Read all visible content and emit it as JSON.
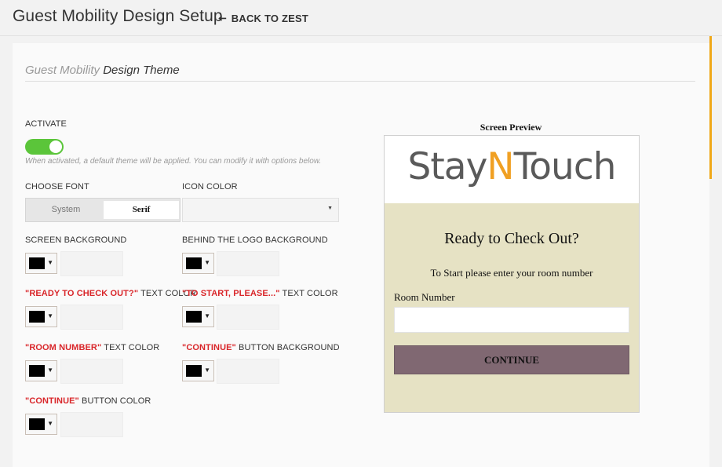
{
  "header": {
    "title": "Guest Mobility Design Setup",
    "back_label": "BACK TO ZEST"
  },
  "section": {
    "title_light": "Guest Mobility",
    "title_dark": "Design Theme"
  },
  "activate": {
    "label": "ACTIVATE",
    "state": "on",
    "helper": "When activated, a default theme will be applied. You can modify it with options below."
  },
  "font": {
    "label": "CHOOSE FONT",
    "options": [
      "System",
      "Serif"
    ],
    "selected": "Serif"
  },
  "icon_color": {
    "label": "ICON COLOR",
    "value": ""
  },
  "color_fields": {
    "screen_bg": {
      "label": "SCREEN BACKGROUND",
      "swatch": "#000000",
      "value": ""
    },
    "logo_bg": {
      "label": "BEHIND THE LOGO BACKGROUND",
      "swatch": "#000000",
      "value": ""
    },
    "ready_text": {
      "quoted": "\"READY TO CHECK OUT?\"",
      "suffix": " TEXT COLOR",
      "swatch": "#000000",
      "value": ""
    },
    "start_text": {
      "quoted": "\"TO START, PLEASE...\"",
      "suffix": " TEXT COLOR",
      "swatch": "#000000",
      "value": ""
    },
    "room_text": {
      "quoted": "\"ROOM NUMBER\"",
      "suffix": " TEXT COLOR",
      "swatch": "#000000",
      "value": ""
    },
    "continue_bg": {
      "quoted": "\"CONTINUE\"",
      "suffix": " BUTTON BACKGROUND",
      "swatch": "#000000",
      "value": ""
    },
    "continue_color": {
      "quoted": "\"CONTINUE\"",
      "suffix": " BUTTON COLOR",
      "swatch": "#000000",
      "value": ""
    }
  },
  "preview": {
    "heading": "Screen Preview",
    "logo_part1": "Stay",
    "logo_accent": "N",
    "logo_part2": "Touch",
    "title": "Ready to Check Out?",
    "subtitle": "To Start please enter your room number",
    "field_label": "Room Number",
    "button_label": "CONTINUE"
  },
  "colors": {
    "accent_orange": "#f0a023",
    "toggle_green": "#5bc53a",
    "label_red": "#d9262a",
    "preview_bg": "#e6e2c4",
    "preview_button": "#806872"
  }
}
